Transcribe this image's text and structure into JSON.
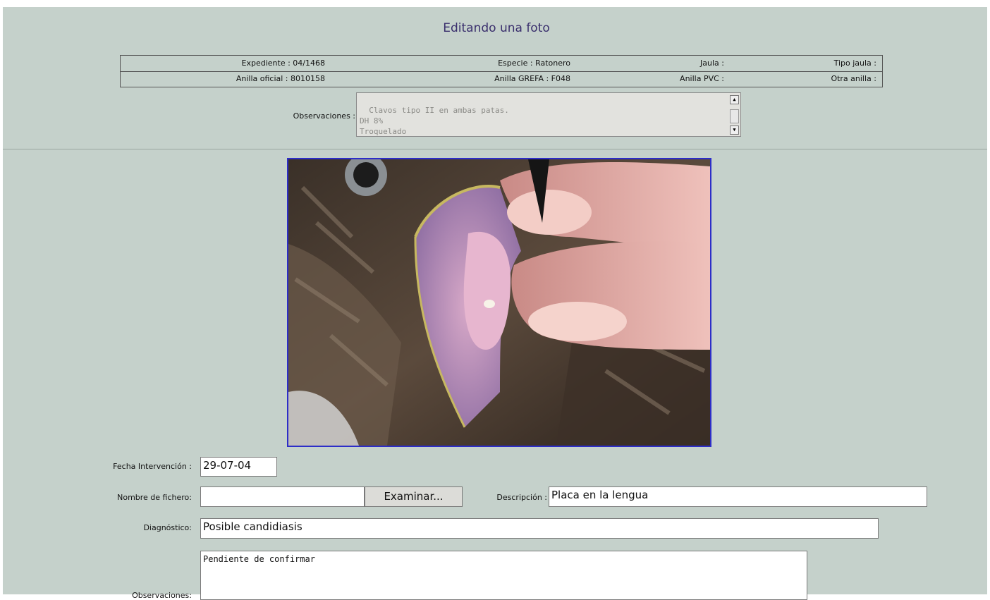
{
  "page": {
    "title": "Editando una foto"
  },
  "info": {
    "row1": {
      "expediente": "Expediente : 04/1468",
      "especie": "Especie : Ratonero",
      "jaula": "Jaula :",
      "tipo_jaula": "Tipo jaula :"
    },
    "row2": {
      "anilla_oficial": "Anilla oficial : 8010158",
      "anilla_grefa": "Anilla GREFA : F048",
      "anilla_pvc": "Anilla PVC :",
      "otra_anilla": "Otra anilla :"
    },
    "observaciones_label": "Observaciones :",
    "observaciones_text": "Clavos tipo II en ambas patas.\nDH 8%\nTroquelado"
  },
  "form": {
    "fecha_label": "Fecha Intervención :",
    "fecha_value": "29-07-04",
    "fichero_label": "Nombre de fichero:",
    "fichero_value": "",
    "browse_label": "Examinar...",
    "descripcion_label": "Descripción :",
    "descripcion_value": "Placa en la lengua",
    "diagnostico_label": "Diagnóstico:",
    "diagnostico_value": "Posible candidiasis",
    "observaciones_label": "Observaciones:",
    "observaciones_value": "Pendiente de confirmar"
  },
  "icons": {
    "scroll_up": "scroll-up-arrow-icon",
    "scroll_down": "scroll-down-arrow-icon"
  },
  "colors": {
    "background": "#c5d1cb",
    "title": "#3a2f6d",
    "photo_border": "#2d2dc8"
  }
}
